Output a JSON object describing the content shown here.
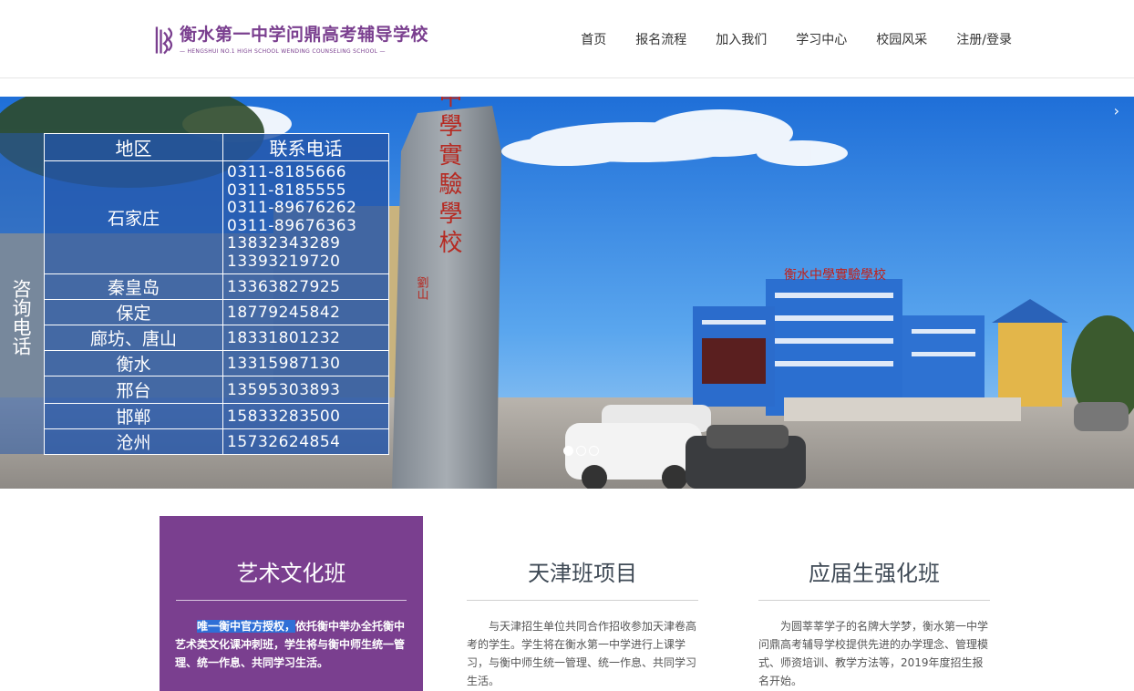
{
  "brand": {
    "name_cn": "衡水第一中学问鼎高考辅导学校",
    "name_en": "HENGSHUI NO.1 HIGH SCHOOL WENDING COUNSELING SCHOOL",
    "color": "#7a3f8f"
  },
  "nav": {
    "items": [
      "首页",
      "报名流程",
      "加入我们",
      "学习中心",
      "校园风采",
      "注册/登录"
    ]
  },
  "banner": {
    "next_icon": "›",
    "stone_text": "衡水中學實驗學校",
    "stone_small": "劉山",
    "building_sign": "衡水中學實驗學校",
    "slides": 3,
    "active_slide": 1,
    "consult_label": "咨询电话",
    "table": {
      "header_region": "地区",
      "header_phone": "联系电话",
      "rows": [
        {
          "region": "石家庄",
          "phones": [
            "0311-8185666",
            "0311-8185555",
            "0311-89676262",
            "0311-89676363",
            "13832343289",
            "13393219720"
          ]
        },
        {
          "region": "秦皇岛",
          "phones": [
            "13363827925"
          ]
        },
        {
          "region": "保定",
          "phones": [
            "18779245842"
          ]
        },
        {
          "region": "廊坊、唐山",
          "phones": [
            "18331801232"
          ]
        },
        {
          "region": "衡水",
          "phones": [
            "13315987130"
          ]
        },
        {
          "region": "邢台",
          "phones": [
            "13595303893"
          ]
        },
        {
          "region": "邯郸",
          "phones": [
            "15833283500"
          ]
        },
        {
          "region": "沧州",
          "phones": [
            "15732624854"
          ]
        }
      ]
    }
  },
  "cards": [
    {
      "title": "艺术文化班",
      "highlight": "唯一衡中官方授权，",
      "text": "依托衡中举办全托衡中艺术类文化课冲刺班，学生将与衡中师生统一管理、统一作息、共同学习生活。"
    },
    {
      "title": "天津班项目",
      "text": "与天津招生单位共同合作招收参加天津卷高考的学生。学生将在衡水第一中学进行上课学习，与衡中师生统一管理、统一作息、共同学习生活。"
    },
    {
      "title": "应届生强化班",
      "text": "为圆莘莘学子的名牌大学梦，衡水第一中学问鼎高考辅导学校提供先进的办学理念、管理模式、师资培训、教学方法等，2019年度招生报名开始。"
    }
  ]
}
